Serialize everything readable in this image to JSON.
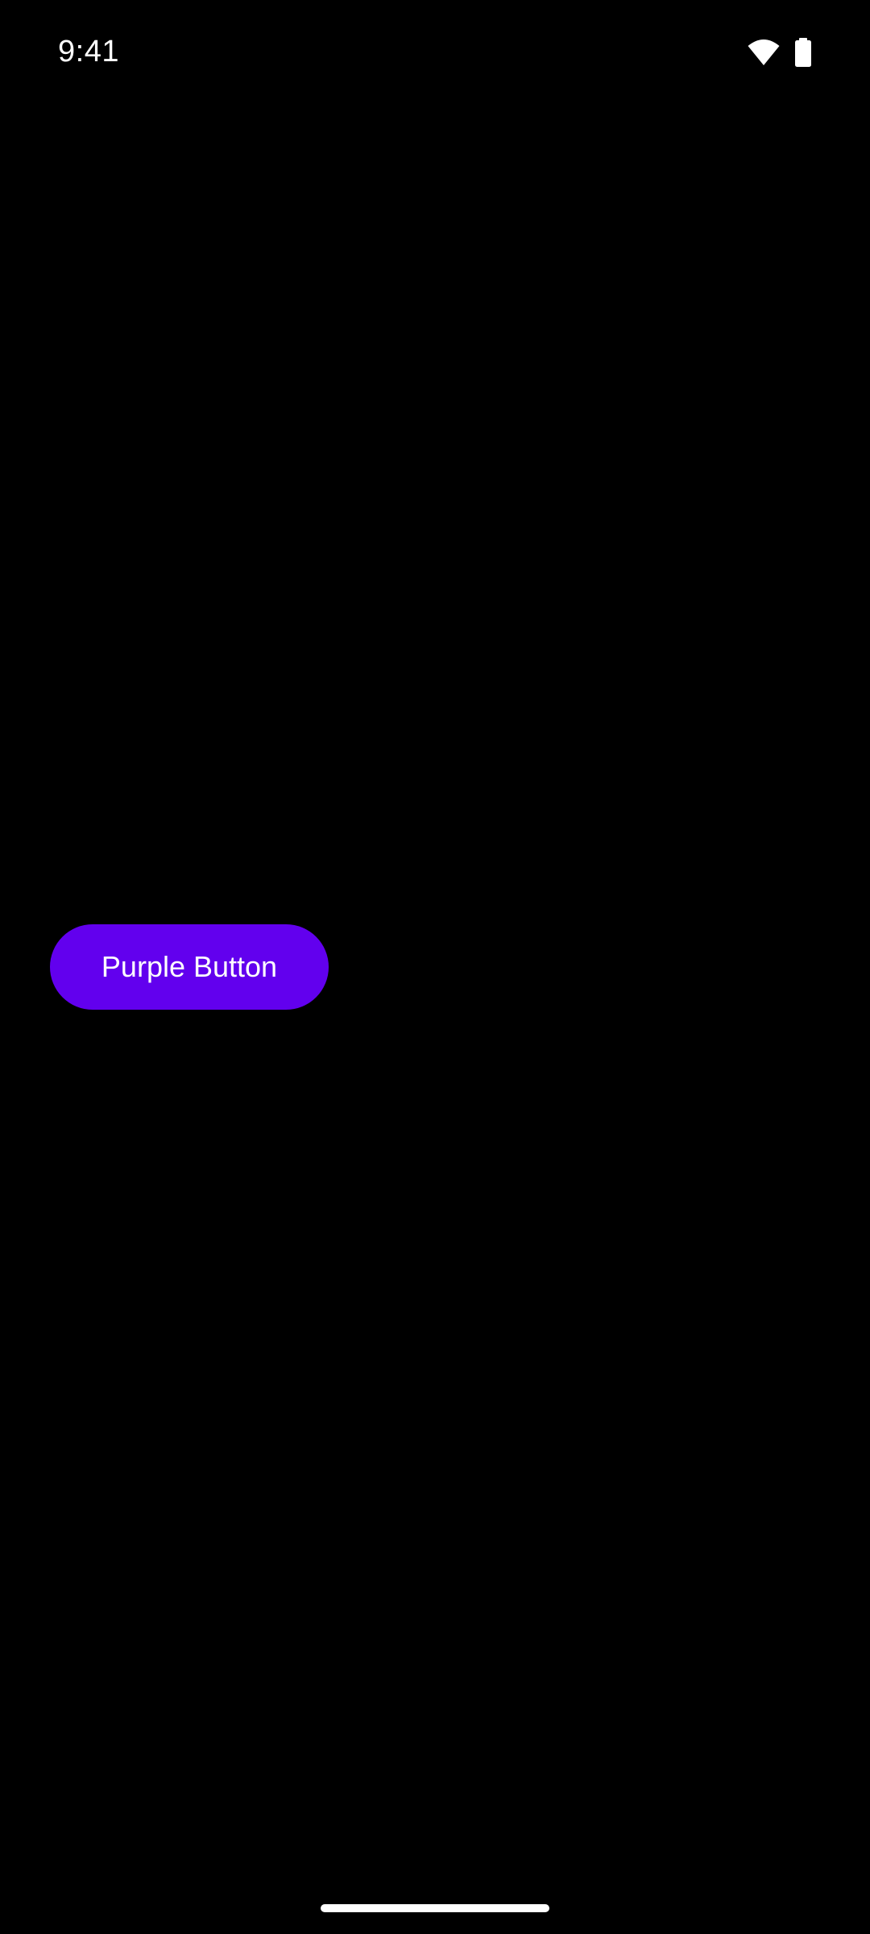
{
  "status_bar": {
    "time": "9:41",
    "icons": [
      "wifi-icon",
      "battery-icon"
    ]
  },
  "main": {
    "button_label": "Purple Button"
  },
  "colors": {
    "background": "#000000",
    "button_background": "#6200EE",
    "foreground": "#FFFFFF"
  }
}
